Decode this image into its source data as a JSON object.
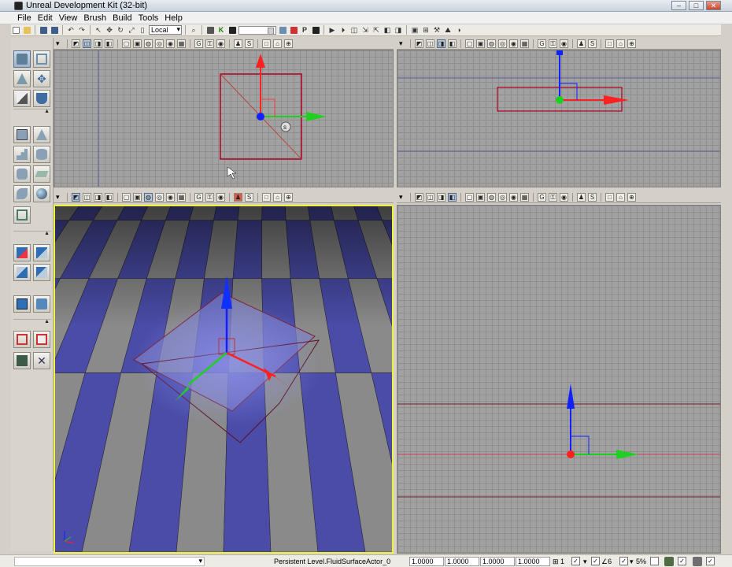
{
  "window": {
    "title": "Unreal Development Kit (32-bit)"
  },
  "menu": [
    "File",
    "Edit",
    "View",
    "Brush",
    "Build",
    "Tools",
    "Help"
  ],
  "toolbar": {
    "transform_space": "Local"
  },
  "viewport_toolbar": {
    "realtime_label": "G",
    "show_label": "S"
  },
  "status": {
    "selection": "Persistent Level.FluidSurfaceActor_0",
    "drag_x": "1.0000",
    "drag_y": "1.0000",
    "drag_z": "1.0000",
    "drag_w": "1.0000",
    "grid_label": "1",
    "rot_label": "∠6",
    "scale_label": "5%"
  },
  "colors": {
    "gizmo_x": "#ff2020",
    "gizmo_y": "#20d020",
    "gizmo_z": "#1020ff",
    "selection_box": "#b00020",
    "active_viewport_border": "#ffff40"
  }
}
